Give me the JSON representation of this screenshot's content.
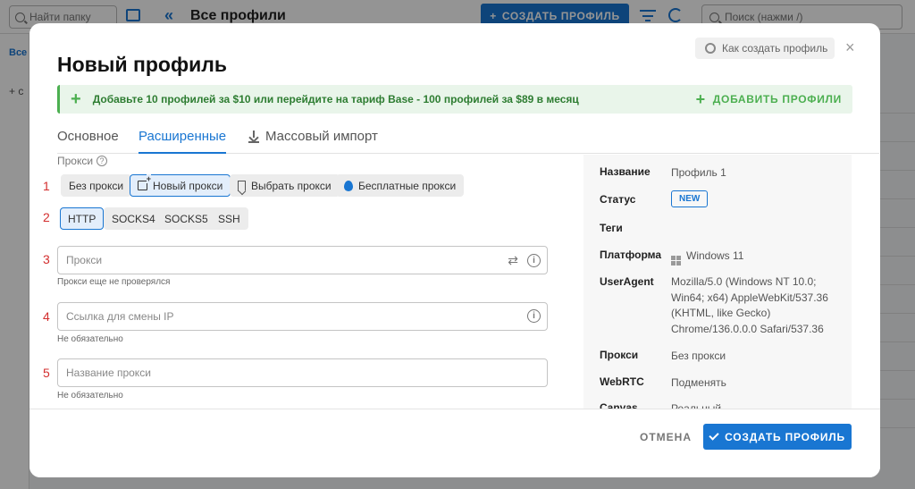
{
  "background": {
    "folder_search_placeholder": "Найти папку",
    "page_title": "Все профили",
    "create_profile_label": "СОЗДАТЬ ПРОФИЛЬ",
    "profile_search_placeholder": "Поиск (нажми /)",
    "sidebar_tab_label": "Все",
    "sidebar_add_label": "+ с"
  },
  "modal": {
    "title": "Новый профиль",
    "howto_label": "Как создать профиль",
    "close_label": "×",
    "banner": {
      "text": "Добавьте 10 профилей за $10 или перейдите на тариф Base - 100 профилей за $89 в месяц",
      "add_label": "ДОБАВИТЬ ПРОФИЛИ"
    },
    "tabs": [
      {
        "label": "Основное"
      },
      {
        "label": "Расширенные"
      },
      {
        "label": "Массовый импорт"
      }
    ],
    "proxy_section_label": "Прокси",
    "step_numbers": [
      "1",
      "2",
      "3",
      "4",
      "5"
    ],
    "proxy_modes": [
      {
        "label": "Без прокси"
      },
      {
        "label": "Новый прокси"
      },
      {
        "label": "Выбрать прокси"
      },
      {
        "label": "Бесплатные прокси"
      }
    ],
    "protocols": [
      {
        "label": "HTTP"
      },
      {
        "label": "SOCKS4"
      },
      {
        "label": "SOCKS5"
      },
      {
        "label": "SSH"
      }
    ],
    "fields": {
      "proxy": {
        "placeholder": "Прокси",
        "hint": "Прокси еще не проверялся"
      },
      "change_ip_url": {
        "placeholder": "Ссылка для смены IP",
        "hint": "Не обязательно"
      },
      "proxy_name": {
        "placeholder": "Название прокси",
        "hint": "Не обязательно"
      }
    },
    "summary": {
      "name": {
        "key": "Название",
        "value": "Профиль 1"
      },
      "status": {
        "key": "Статус",
        "value": "NEW"
      },
      "tags": {
        "key": "Теги",
        "value": ""
      },
      "platform": {
        "key": "Платформа",
        "value": "Windows 11"
      },
      "useragent": {
        "key": "UserAgent",
        "value": "Mozilla/5.0 (Windows NT 10.0; Win64; x64) AppleWebKit/537.36 (KHTML, like Gecko) Chrome/136.0.0.0 Safari/537.36"
      },
      "proxy": {
        "key": "Прокси",
        "value": "Без прокси"
      },
      "webrtc": {
        "key": "WebRTC",
        "value": "Подменять"
      },
      "canvas": {
        "key": "Canvas",
        "value": "Реальный"
      }
    },
    "footer": {
      "cancel_label": "ОТМЕНА",
      "create_label": "СОЗДАТЬ ПРОФИЛЬ"
    }
  },
  "colors": {
    "accent": "#1976d2",
    "banner_green": "#4caf50",
    "step_red": "#d32f2f"
  }
}
